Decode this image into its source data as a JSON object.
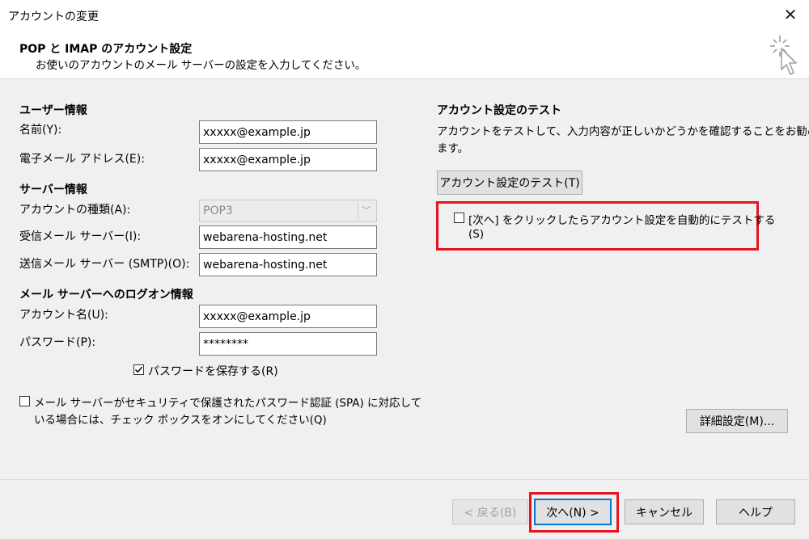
{
  "window": {
    "title": "アカウントの変更",
    "close_glyph": "✕"
  },
  "header": {
    "title": "POP と IMAP のアカウント設定",
    "subtitle": "お使いのアカウントのメール サーバーの設定を入力してください。",
    "icon": "magic-wand-cursor-icon"
  },
  "user_info": {
    "heading": "ユーザー情報",
    "name_label": "名前(Y):",
    "name_value": "xxxxx@example.jp",
    "email_label": "電子メール アドレス(E):",
    "email_value": "xxxxx@example.jp"
  },
  "server_info": {
    "heading": "サーバー情報",
    "account_type_label": "アカウントの種類(A):",
    "account_type_value": "POP3",
    "incoming_label": "受信メール サーバー(I):",
    "incoming_value": "webarena-hosting.net",
    "outgoing_label": "送信メール サーバー (SMTP)(O):",
    "outgoing_value": "webarena-hosting.net"
  },
  "logon_info": {
    "heading": "メール サーバーへのログオン情報",
    "account_name_label": "アカウント名(U):",
    "account_name_value": "xxxxx@example.jp",
    "password_label": "パスワード(P):",
    "password_value": "********",
    "save_password_label": "パスワードを保存する(R)",
    "save_password_checked": true
  },
  "spa": {
    "label_line1": "メール サーバーがセキュリティで保護されたパスワード認証 (SPA) に対応して",
    "label_line2": "いる場合には、チェック ボックスをオンにしてください(Q)",
    "checked": false
  },
  "test_section": {
    "heading": "アカウント設定のテスト",
    "description_line1": "アカウントをテストして、入力内容が正しいかどうかを確認することをお勧めし",
    "description_line2": "ます。",
    "test_button": "アカウント設定のテスト(T)",
    "auto_test_line1": "[次へ] をクリックしたらアカウント設定を自動的にテストする",
    "auto_test_line2": "(S)",
    "auto_test_checked": false
  },
  "more_settings_button": "詳細設定(M)...",
  "footer": {
    "back": "< 戻る(B)",
    "next": "次へ(N) >",
    "cancel": "キャンセル",
    "help": "ヘルプ"
  },
  "colors": {
    "highlight": "#e5121f",
    "focus": "#0078d7"
  }
}
